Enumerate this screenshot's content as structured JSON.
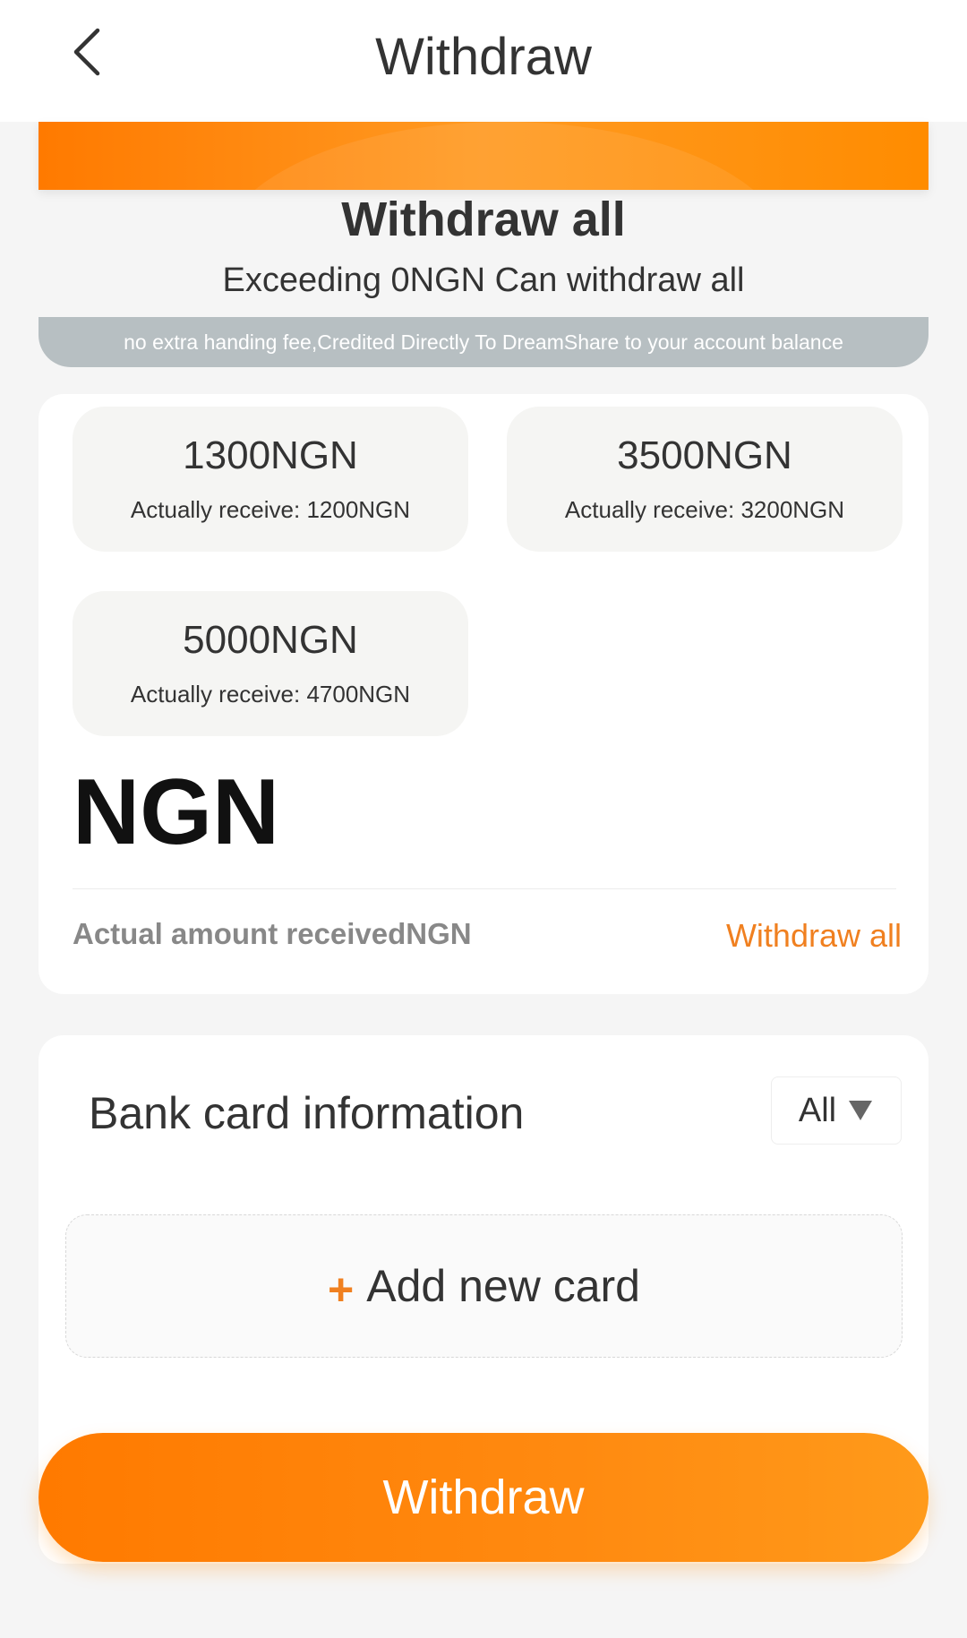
{
  "header": {
    "title": "Withdraw",
    "back_icon": "chevron-left-icon"
  },
  "withdraw_all_section": {
    "title": "Withdraw all",
    "subtitle": "Exceeding 0NGN Can withdraw all",
    "note": "no extra handing fee,Credited Directly To DreamShare to your account balance"
  },
  "amount_options": [
    {
      "amount": "1300NGN",
      "receive": "Actually receive: 1200NGN"
    },
    {
      "amount": "3500NGN",
      "receive": "Actually receive: 3200NGN"
    },
    {
      "amount": "5000NGN",
      "receive": "Actually receive: 4700NGN"
    }
  ],
  "amount_input": {
    "currency": "NGN",
    "actual_label": "Actual amount receivedNGN",
    "withdraw_all_link": "Withdraw all"
  },
  "bank": {
    "title": "Bank card information",
    "filter_label": "All",
    "add_plus": "+",
    "add_label": "Add new card"
  },
  "withdraw_button": "Withdraw",
  "colors": {
    "accent": "#ff8000",
    "link": "#f08020",
    "note_bg": "#b7bfc2"
  }
}
